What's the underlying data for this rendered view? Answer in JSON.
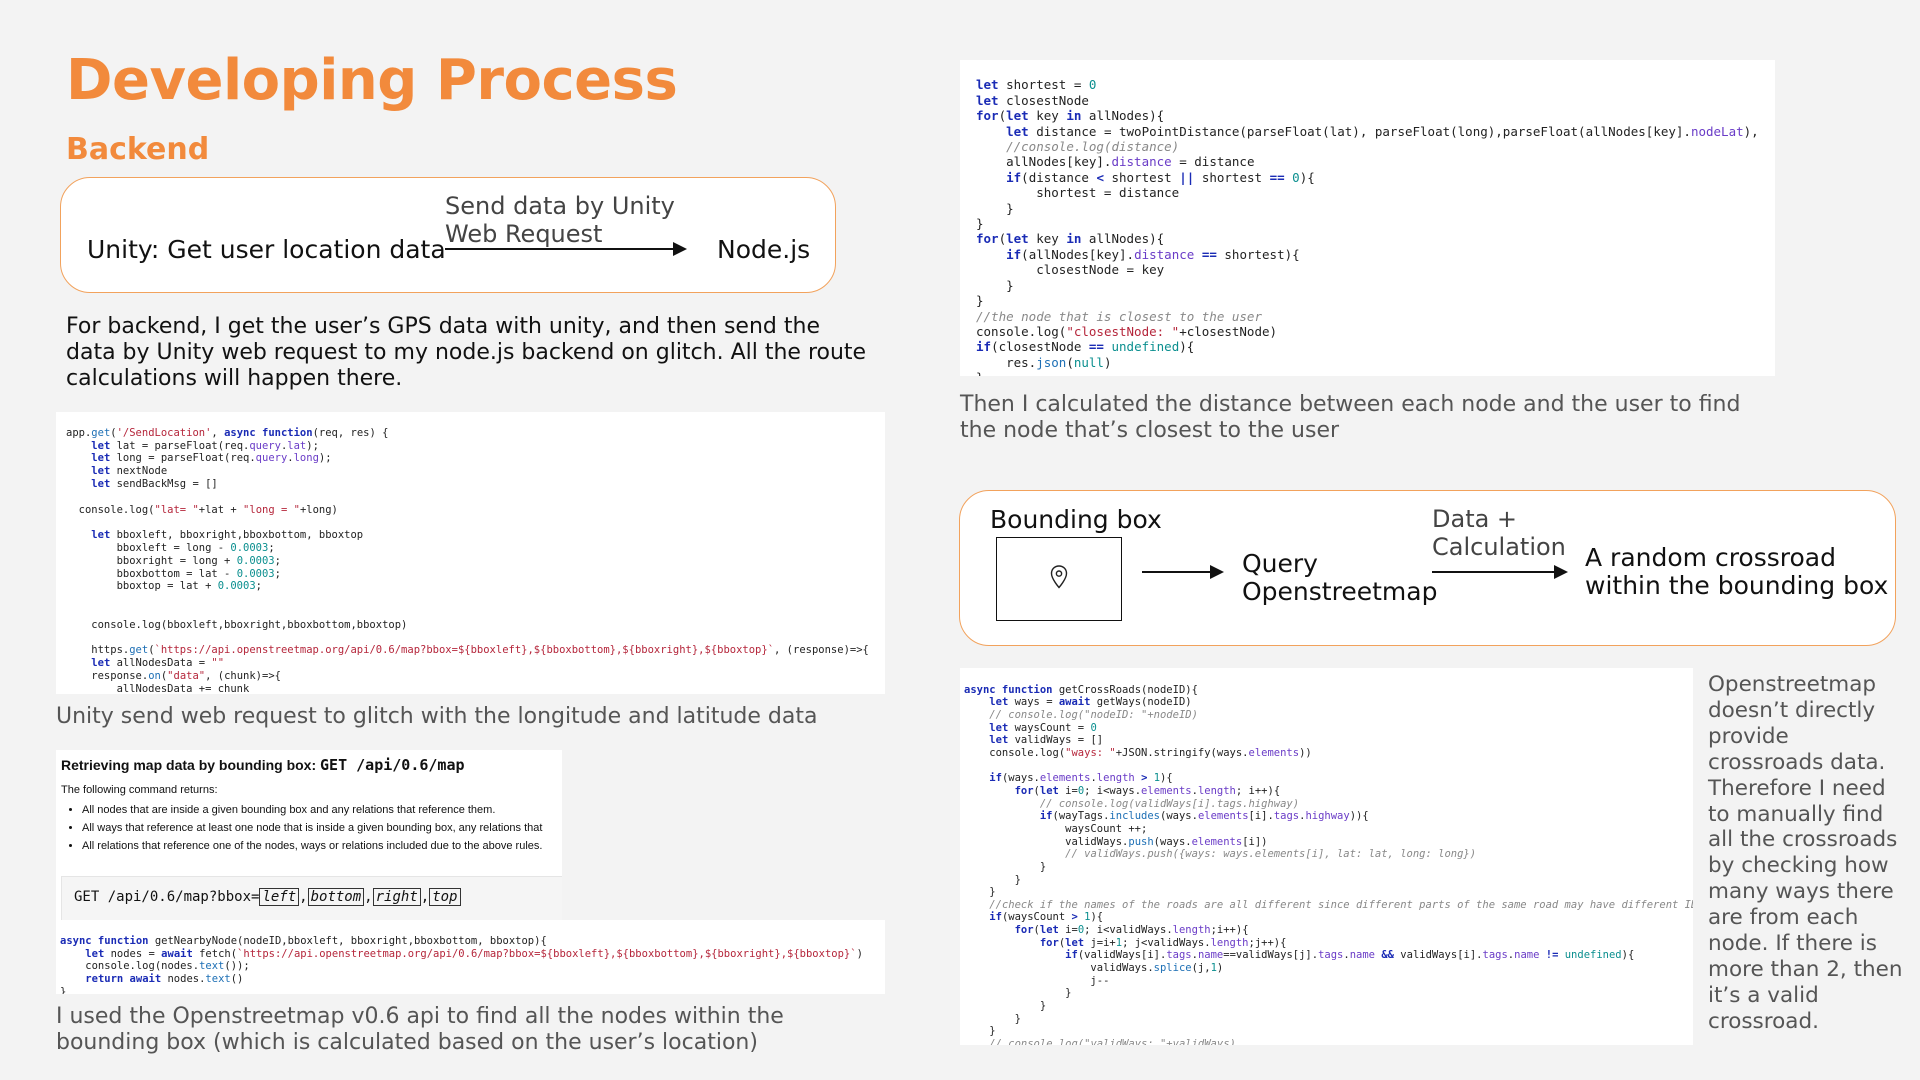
{
  "header": {
    "title": "Developing Process",
    "subtitle": "Backend"
  },
  "flow1": {
    "left": "Unity: Get user location data",
    "label_line1": "Send data by Unity",
    "label_line2": "Web Request",
    "right": "Node.js"
  },
  "para1": "For backend, I get the user’s GPS data with unity, and then send the data by Unity web request to my node.js backend on glitch. All the route calculations will happen there.",
  "caption1": "Unity send web request to glitch with the longitude and  latitude data",
  "caption2": "I used the Openstreetmap v0.6 api to find all the nodes within the bounding box (which is calculated based on the user’s location)",
  "caption3": "Then I calculated the distance between each node and the user to find the node that’s closest to the user",
  "flow2": {
    "title": "Bounding box",
    "icon": "location-pin-icon",
    "query_line1": "Query",
    "query_line2": "Openstreetmap",
    "label_line1": "Data +",
    "label_line2": "Calculation",
    "result_line1": "A random crossroad",
    "result_line2": "within the bounding box"
  },
  "side_note": "Openstreetmap doesn’t directly provide crossroads data. Therefore I need to manually find all the crossroads by checking how many ways there are from each node. If there is more than 2, then it’s a valid crossroad.",
  "doc": {
    "heading_prefix": "Retrieving map data by bounding box:",
    "heading_code": "GET /api/0.6/map",
    "returns": "The following command returns:",
    "bullets": [
      "All nodes that are inside a given bounding box and any relations that reference them.",
      "All ways that reference at least one node that is inside a given bounding box, any relations that",
      "All relations that reference one of the nodes, ways or relations included due to the above rules."
    ],
    "url_prefix": "GET /api/0.6/map?bbox=",
    "url_params": [
      "left",
      "bottom",
      "right",
      "top"
    ]
  },
  "colors": {
    "accent": "#f28a3c",
    "box_border": "#f2a25c"
  }
}
